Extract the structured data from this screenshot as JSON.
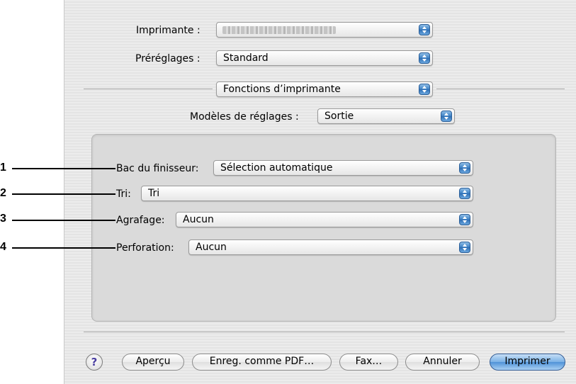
{
  "dialog": {
    "printer": {
      "label": "Imprimante :",
      "value": ""
    },
    "presets": {
      "label": "Préréglages :",
      "value": "Standard"
    },
    "pane_selector": {
      "value": "Fonctions d’imprimante"
    },
    "feature_sets": {
      "label": "Modèles de réglages :",
      "value": "Sortie"
    }
  },
  "output_settings": [
    {
      "callout": "1",
      "label": "Bac du finisseur:",
      "value": "Sélection automatique"
    },
    {
      "callout": "2",
      "label": "Tri:",
      "value": "Tri"
    },
    {
      "callout": "3",
      "label": "Agrafage:",
      "value": "Aucun"
    },
    {
      "callout": "4",
      "label": "Perforation:",
      "value": "Aucun"
    }
  ],
  "buttons": {
    "help": "?",
    "preview": "Aperçu",
    "save_pdf": "Enreg. comme PDF…",
    "fax": "Fax…",
    "cancel": "Annuler",
    "print": "Imprimer"
  },
  "colors": {
    "accent": "#4f92d8",
    "callout": "#000000"
  }
}
